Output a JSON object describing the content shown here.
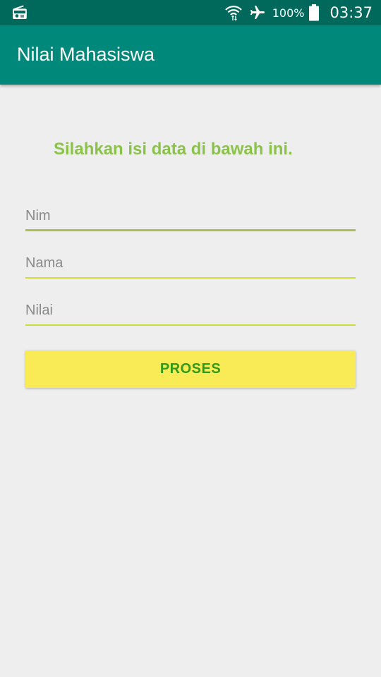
{
  "status_bar": {
    "battery": "100%",
    "time": "03:37",
    "icons": [
      "radio-icon",
      "wifi-icon",
      "airplane-icon",
      "battery-icon"
    ]
  },
  "app_bar": {
    "title": "Nilai Mahasiswa"
  },
  "form": {
    "instruction": "Silahkan isi data di bawah ini.",
    "nim": {
      "placeholder": "Nim",
      "value": ""
    },
    "nama": {
      "placeholder": "Nama",
      "value": ""
    },
    "nilai": {
      "placeholder": "Nilai",
      "value": ""
    },
    "submit_label": "PROSES"
  },
  "colors": {
    "status_bar": "#00695c",
    "app_bar": "#00897b",
    "instruction_text": "#8bc34a",
    "field_underline": "#cddc39",
    "button_bg": "#f9eb55",
    "button_text": "#2e9b1a",
    "background": "#eeeeee"
  }
}
